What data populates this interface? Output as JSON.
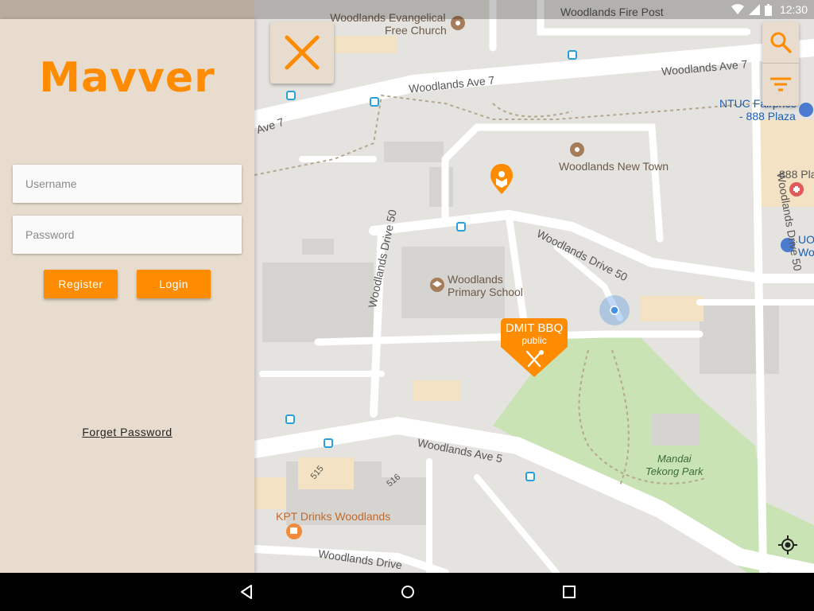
{
  "status_bar": {
    "time": "12:30"
  },
  "app": {
    "name": "Mavver"
  },
  "login": {
    "username_placeholder": "Username",
    "password_placeholder": "Password",
    "register_label": "Register",
    "login_label": "Login",
    "forget_label": "Forget Password"
  },
  "colors": {
    "accent": "#ff8c00",
    "panel": "#e7dccd"
  },
  "map": {
    "streets": [
      "Woodlands Ave 7",
      "Woodlands Ave 7",
      "Ave 7",
      "Woodlands Drive 50",
      "Woodlands Drive 50",
      "Woodlands Drive 50",
      "Woodlands Ave 5",
      "Woodlands Drive"
    ],
    "places": {
      "church": "Woodlands Evangelical Free Church",
      "church_line1": "Woodlands Evangelical",
      "church_line2": "Free Church",
      "fire_post": "Woodlands Fire Post",
      "new_town": "Woodlands New Town",
      "school_line1": "Woodlands",
      "school_line2": "Primary School",
      "ntuc_line1": "NTUC Fairprice",
      "ntuc_line2": "- 888 Plaza",
      "plaza": "888 Pla",
      "uo_line1": "UO",
      "uo_line2": "Wo",
      "park_line1": "Mandai",
      "park_line2": "Tekong Park",
      "kpt": "KPT Drinks Woodlands",
      "block_515": "515",
      "block_516": "516"
    }
  },
  "marker": {
    "title": "DMIT BBQ",
    "subtitle": "public",
    "icon": "cutlery-icon"
  },
  "controls": {
    "close_icon": "close-icon",
    "search_icon": "search-icon",
    "filter_icon": "filter-icon",
    "location_icon": "my-location-icon"
  },
  "nav": {
    "back_icon": "back-icon",
    "home_icon": "home-icon",
    "recent_icon": "recent-apps-icon"
  }
}
